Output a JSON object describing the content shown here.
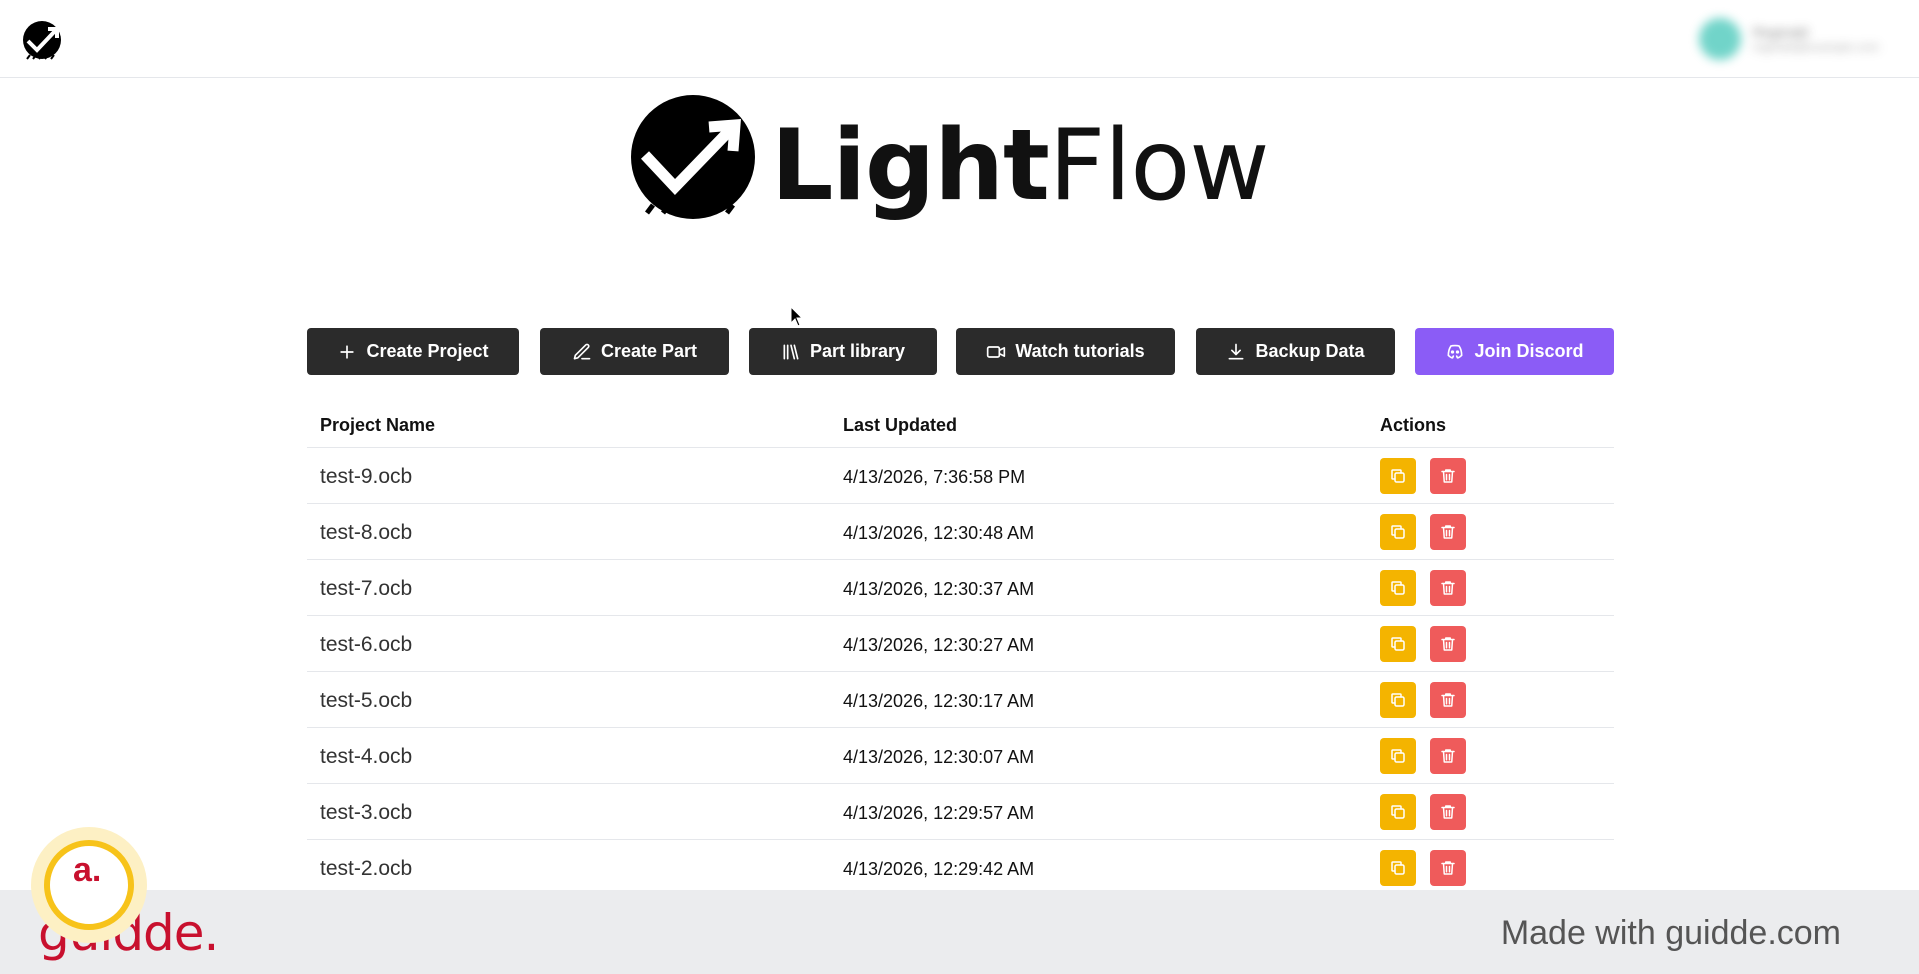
{
  "header": {
    "logo_icon": "lightflow-logo-icon",
    "user_name": "Reginald",
    "user_email": "reginald@example.com"
  },
  "hero": {
    "brand_bold": "Light",
    "brand_regular": "Flow"
  },
  "toolbar": {
    "create_project": "Create Project",
    "create_part": "Create Part",
    "part_library": "Part library",
    "watch_tutorials": "Watch tutorials",
    "backup_data": "Backup Data",
    "join_discord": "Join Discord",
    "discord_color": "#8b5cf6"
  },
  "table": {
    "headers": {
      "name": "Project Name",
      "updated": "Last Updated",
      "actions": "Actions"
    },
    "rows": [
      {
        "name": "test-9.ocb",
        "updated": "4/13/2026, 7:36:58 PM"
      },
      {
        "name": "test-8.ocb",
        "updated": "4/13/2026, 12:30:48 AM"
      },
      {
        "name": "test-7.ocb",
        "updated": "4/13/2026, 12:30:37 AM"
      },
      {
        "name": "test-6.ocb",
        "updated": "4/13/2026, 12:30:27 AM"
      },
      {
        "name": "test-5.ocb",
        "updated": "4/13/2026, 12:30:17 AM"
      },
      {
        "name": "test-4.ocb",
        "updated": "4/13/2026, 12:30:07 AM"
      },
      {
        "name": "test-3.ocb",
        "updated": "4/13/2026, 12:29:57 AM"
      },
      {
        "name": "test-2.ocb",
        "updated": "4/13/2026, 12:29:42 AM"
      }
    ],
    "copy_color": "#f4b400",
    "delete_color": "#ef5b5b"
  },
  "footer": {
    "brand": "guidde.",
    "made_with": "Made with guidde.com",
    "badge_letter": "a."
  }
}
